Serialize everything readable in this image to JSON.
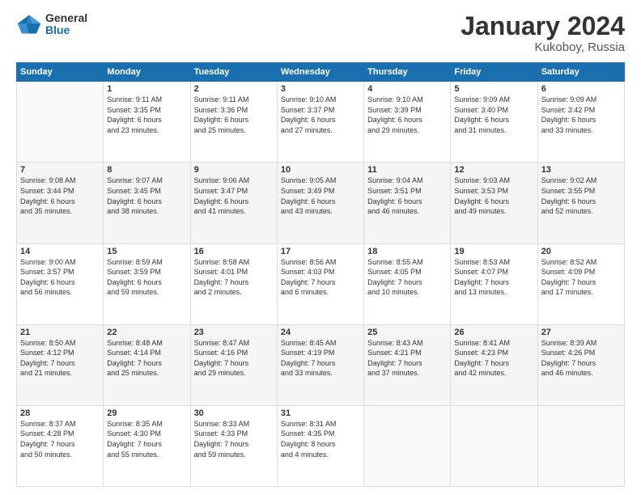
{
  "logo": {
    "general": "General",
    "blue": "Blue"
  },
  "header": {
    "month_year": "January 2024",
    "location": "Kukoboy, Russia"
  },
  "weekdays": [
    "Sunday",
    "Monday",
    "Tuesday",
    "Wednesday",
    "Thursday",
    "Friday",
    "Saturday"
  ],
  "weeks": [
    [
      {
        "day": "",
        "info": ""
      },
      {
        "day": "1",
        "info": "Sunrise: 9:11 AM\nSunset: 3:35 PM\nDaylight: 6 hours\nand 23 minutes."
      },
      {
        "day": "2",
        "info": "Sunrise: 9:11 AM\nSunset: 3:36 PM\nDaylight: 6 hours\nand 25 minutes."
      },
      {
        "day": "3",
        "info": "Sunrise: 9:10 AM\nSunset: 3:37 PM\nDaylight: 6 hours\nand 27 minutes."
      },
      {
        "day": "4",
        "info": "Sunrise: 9:10 AM\nSunset: 3:39 PM\nDaylight: 6 hours\nand 29 minutes."
      },
      {
        "day": "5",
        "info": "Sunrise: 9:09 AM\nSunset: 3:40 PM\nDaylight: 6 hours\nand 31 minutes."
      },
      {
        "day": "6",
        "info": "Sunrise: 9:09 AM\nSunset: 3:42 PM\nDaylight: 6 hours\nand 33 minutes."
      }
    ],
    [
      {
        "day": "7",
        "info": "Sunrise: 9:08 AM\nSunset: 3:44 PM\nDaylight: 6 hours\nand 35 minutes."
      },
      {
        "day": "8",
        "info": "Sunrise: 9:07 AM\nSunset: 3:45 PM\nDaylight: 6 hours\nand 38 minutes."
      },
      {
        "day": "9",
        "info": "Sunrise: 9:06 AM\nSunset: 3:47 PM\nDaylight: 6 hours\nand 41 minutes."
      },
      {
        "day": "10",
        "info": "Sunrise: 9:05 AM\nSunset: 3:49 PM\nDaylight: 6 hours\nand 43 minutes."
      },
      {
        "day": "11",
        "info": "Sunrise: 9:04 AM\nSunset: 3:51 PM\nDaylight: 6 hours\nand 46 minutes."
      },
      {
        "day": "12",
        "info": "Sunrise: 9:03 AM\nSunset: 3:53 PM\nDaylight: 6 hours\nand 49 minutes."
      },
      {
        "day": "13",
        "info": "Sunrise: 9:02 AM\nSunset: 3:55 PM\nDaylight: 6 hours\nand 52 minutes."
      }
    ],
    [
      {
        "day": "14",
        "info": "Sunrise: 9:00 AM\nSunset: 3:57 PM\nDaylight: 6 hours\nand 56 minutes."
      },
      {
        "day": "15",
        "info": "Sunrise: 8:59 AM\nSunset: 3:59 PM\nDaylight: 6 hours\nand 59 minutes."
      },
      {
        "day": "16",
        "info": "Sunrise: 8:58 AM\nSunset: 4:01 PM\nDaylight: 7 hours\nand 2 minutes."
      },
      {
        "day": "17",
        "info": "Sunrise: 8:56 AM\nSunset: 4:03 PM\nDaylight: 7 hours\nand 6 minutes."
      },
      {
        "day": "18",
        "info": "Sunrise: 8:55 AM\nSunset: 4:05 PM\nDaylight: 7 hours\nand 10 minutes."
      },
      {
        "day": "19",
        "info": "Sunrise: 8:53 AM\nSunset: 4:07 PM\nDaylight: 7 hours\nand 13 minutes."
      },
      {
        "day": "20",
        "info": "Sunrise: 8:52 AM\nSunset: 4:09 PM\nDaylight: 7 hours\nand 17 minutes."
      }
    ],
    [
      {
        "day": "21",
        "info": "Sunrise: 8:50 AM\nSunset: 4:12 PM\nDaylight: 7 hours\nand 21 minutes."
      },
      {
        "day": "22",
        "info": "Sunrise: 8:48 AM\nSunset: 4:14 PM\nDaylight: 7 hours\nand 25 minutes."
      },
      {
        "day": "23",
        "info": "Sunrise: 8:47 AM\nSunset: 4:16 PM\nDaylight: 7 hours\nand 29 minutes."
      },
      {
        "day": "24",
        "info": "Sunrise: 8:45 AM\nSunset: 4:19 PM\nDaylight: 7 hours\nand 33 minutes."
      },
      {
        "day": "25",
        "info": "Sunrise: 8:43 AM\nSunset: 4:21 PM\nDaylight: 7 hours\nand 37 minutes."
      },
      {
        "day": "26",
        "info": "Sunrise: 8:41 AM\nSunset: 4:23 PM\nDaylight: 7 hours\nand 42 minutes."
      },
      {
        "day": "27",
        "info": "Sunrise: 8:39 AM\nSunset: 4:26 PM\nDaylight: 7 hours\nand 46 minutes."
      }
    ],
    [
      {
        "day": "28",
        "info": "Sunrise: 8:37 AM\nSunset: 4:28 PM\nDaylight: 7 hours\nand 50 minutes."
      },
      {
        "day": "29",
        "info": "Sunrise: 8:35 AM\nSunset: 4:30 PM\nDaylight: 7 hours\nand 55 minutes."
      },
      {
        "day": "30",
        "info": "Sunrise: 8:33 AM\nSunset: 4:33 PM\nDaylight: 7 hours\nand 59 minutes."
      },
      {
        "day": "31",
        "info": "Sunrise: 8:31 AM\nSunset: 4:35 PM\nDaylight: 8 hours\nand 4 minutes."
      },
      {
        "day": "",
        "info": ""
      },
      {
        "day": "",
        "info": ""
      },
      {
        "day": "",
        "info": ""
      }
    ]
  ]
}
